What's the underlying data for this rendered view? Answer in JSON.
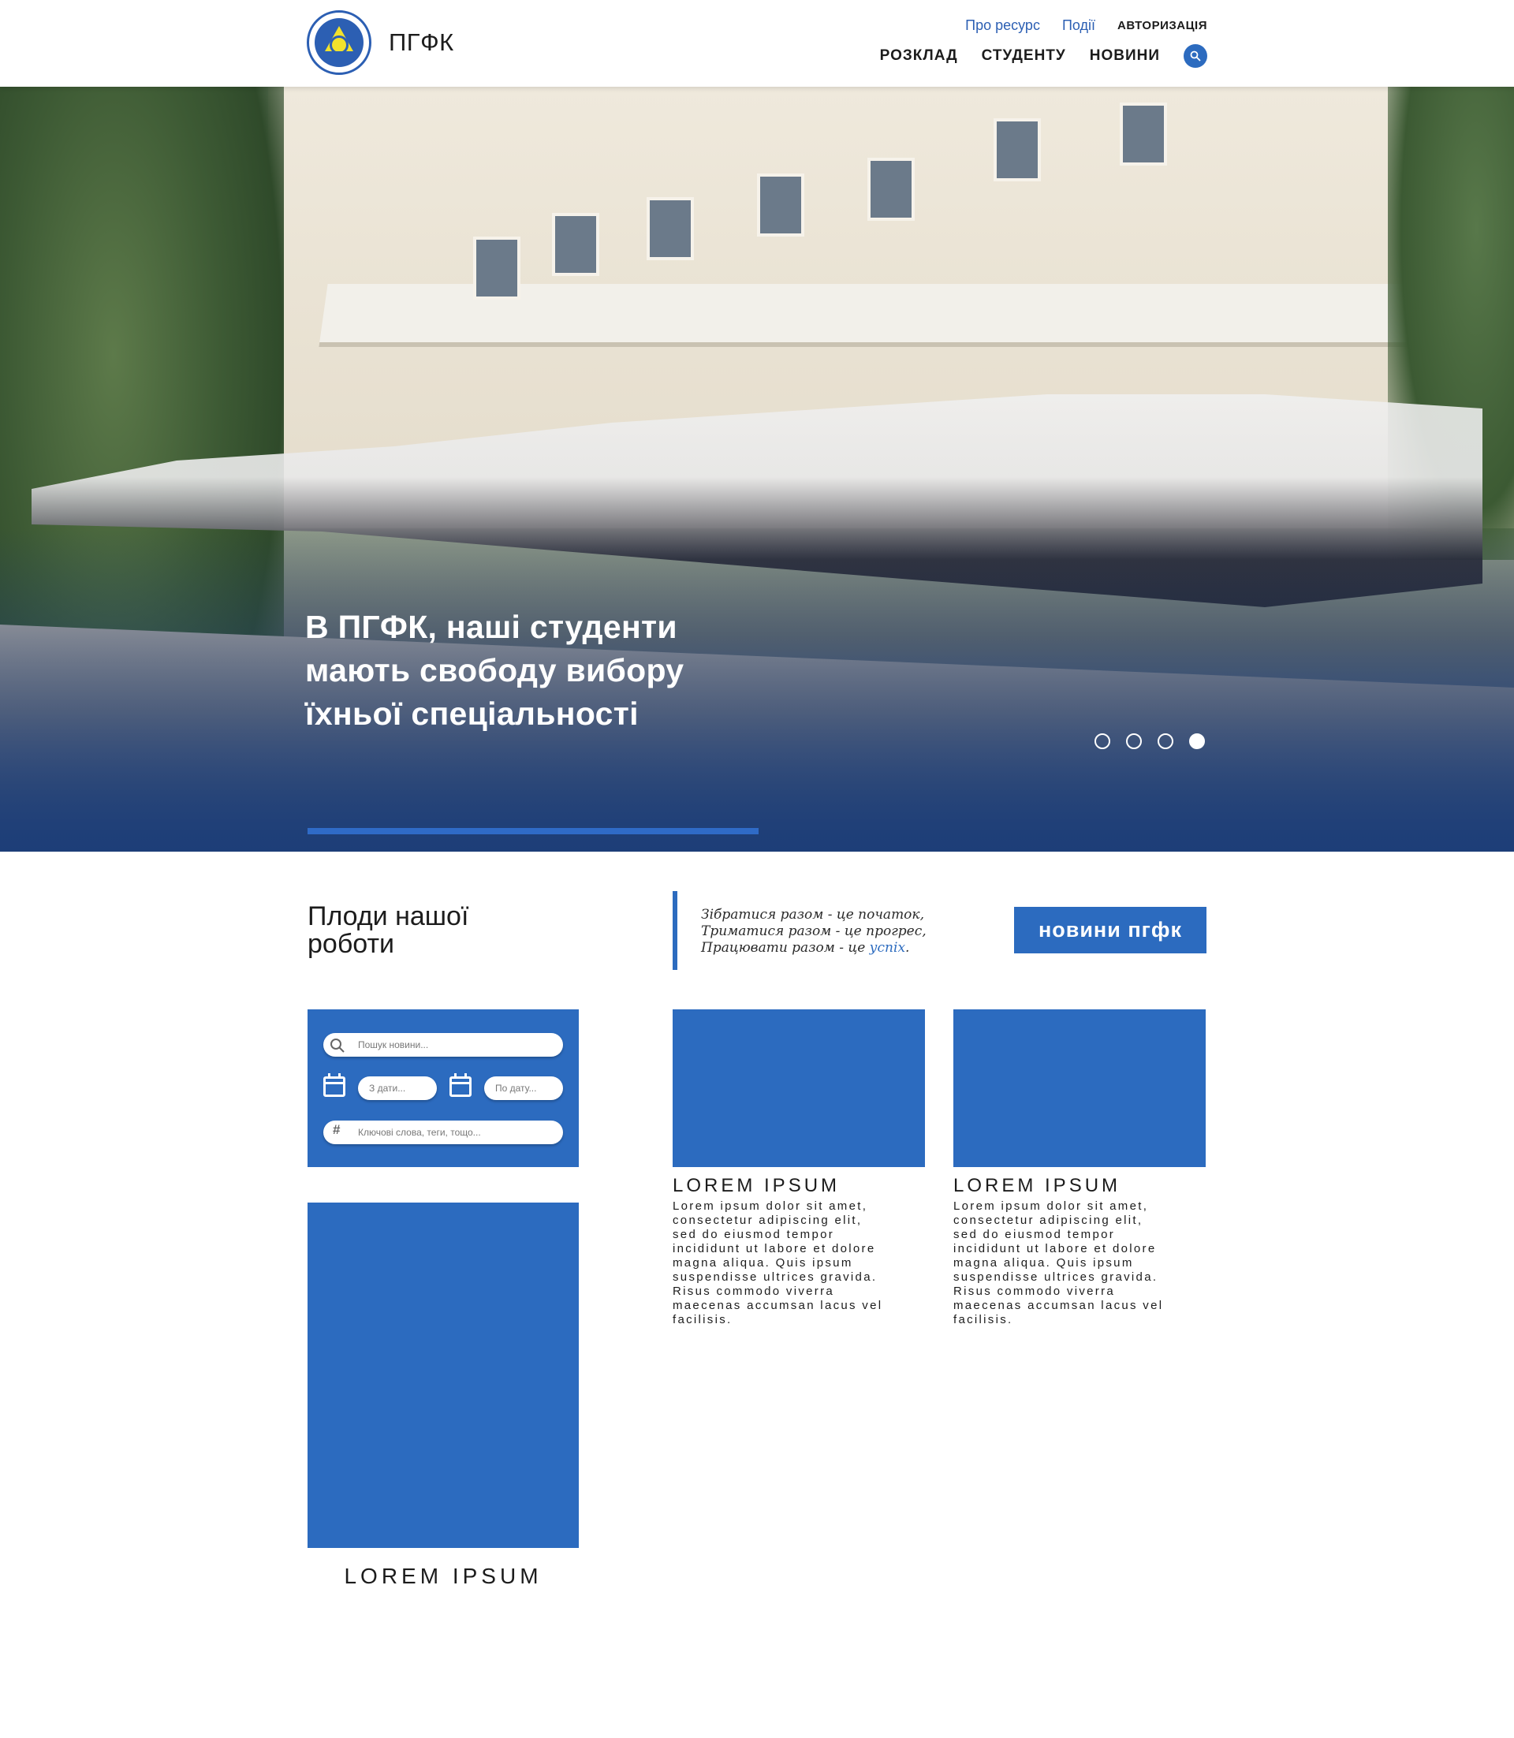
{
  "header": {
    "site_name": "ПГФК",
    "top_links": [
      "Про ресурс",
      "Події",
      "АВТОРИЗАЦІЯ"
    ],
    "nav": [
      "РОЗКЛАД",
      "СТУДЕНТУ",
      "НОВИНИ"
    ]
  },
  "hero": {
    "title_lines": [
      "В ПГФК, наші студенти",
      "мають свободу вибору",
      "їхньої спеціальності"
    ],
    "slides_count": 4,
    "active_slide": 4
  },
  "section": {
    "title_lines": [
      "Плоди нашої",
      "роботи"
    ],
    "quote_lines": [
      "Зібратися разом - це початок,",
      "Триматися разом - це прогрес,",
      "Працювати разом - це "
    ],
    "quote_highlight": "успіх",
    "quote_end": ".",
    "news_button": "новини пгфк"
  },
  "filter": {
    "search_placeholder": "Пошук новини...",
    "from_date_placeholder": "З дати...",
    "to_date_placeholder": "По дату...",
    "tags_placeholder": "Ключові слова, теги, тощо..."
  },
  "cards": {
    "big_title": "LOREM IPSUM",
    "items": [
      {
        "title": "LOREM IPSUM",
        "text_lines": [
          "Lorem ipsum dolor sit amet,",
          "consectetur adipiscing elit,",
          "sed do eiusmod tempor",
          "incididunt ut labore et dolore",
          "magna aliqua. Quis ipsum",
          "suspendisse ultrices gravida.",
          "Risus commodo viverra",
          "maecenas accumsan lacus vel",
          "facilisis."
        ]
      },
      {
        "title": "LOREM IPSUM",
        "text_lines": [
          "Lorem ipsum dolor sit amet,",
          "consectetur adipiscing elit,",
          "sed do eiusmod tempor",
          "incididunt ut labore et dolore",
          "magna aliqua. Quis ipsum",
          "suspendisse ultrices gravida.",
          "Risus commodo viverra",
          "maecenas accumsan lacus vel",
          "facilisis."
        ]
      }
    ]
  },
  "colors": {
    "accent": "#2c6bbf",
    "hero_bottom": "#1d3e78"
  }
}
